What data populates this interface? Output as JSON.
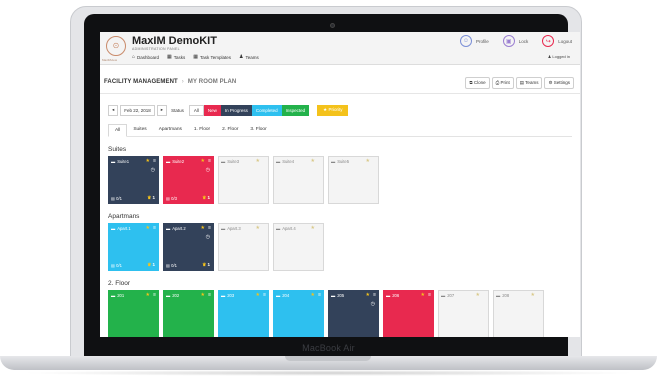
{
  "device_label": "MacBook Air",
  "app": {
    "logo_text": "⊙",
    "logo_sub": "MaxIMview",
    "title": "MaxIM DemoKIT",
    "subtitle": "ADMINISTRATION PANEL",
    "nav": [
      {
        "icon": "⌂",
        "label": "Dashboard"
      },
      {
        "icon": "▦",
        "label": "Tasks"
      },
      {
        "icon": "▦",
        "label": "Task Templates"
      },
      {
        "icon": "♟",
        "label": "Teams"
      }
    ],
    "actions": [
      {
        "icon": "☺",
        "label": "Profile",
        "color": "#7b8fd6"
      },
      {
        "icon": "▣",
        "label": "Lock",
        "color": "#9b7fd1"
      },
      {
        "icon": "↪",
        "label": "Logout",
        "color": "#e8294f"
      }
    ],
    "logged_in": "Logged in"
  },
  "page": {
    "breadcrumb_main": "FACILITY MANAGEMENT",
    "breadcrumb_sep": "›",
    "breadcrumb_sub": "MY ROOM PLAN",
    "buttons": [
      "⧉ Clone",
      "⎙ Print",
      "▤ Teams",
      "⚙ Settings"
    ]
  },
  "filters": {
    "prev": "◂",
    "date": "Feb 22, 2018",
    "next": "▸",
    "status_label": "Status",
    "statuses": [
      {
        "key": "all",
        "label": "All"
      },
      {
        "key": "new",
        "label": "New"
      },
      {
        "key": "prog",
        "label": "In Progress"
      },
      {
        "key": "comp",
        "label": "Completed"
      },
      {
        "key": "insp",
        "label": "Inspected"
      }
    ],
    "priority": "★ Priority"
  },
  "tabs": [
    "All",
    "Suites",
    "Apartmans",
    "1. Floor",
    "2. Floor",
    "3. Floor"
  ],
  "sections": [
    {
      "title": "Suites",
      "rooms": [
        {
          "name": "Suite1",
          "style": "navy",
          "menu": true,
          "clock": true,
          "foot": "0/1",
          "badge": "1"
        },
        {
          "name": "Suite2",
          "style": "red",
          "menu": true,
          "clock": true,
          "foot": "0/3",
          "badge": "1"
        },
        {
          "name": "Suite3",
          "style": "empty"
        },
        {
          "name": "Suite4",
          "style": "empty"
        },
        {
          "name": "Suite5",
          "style": "empty"
        }
      ]
    },
    {
      "title": "Apartmans",
      "rooms": [
        {
          "name": "Apart.1",
          "style": "blue",
          "menu": true,
          "clock": false,
          "foot": "0/1",
          "badge": "1"
        },
        {
          "name": "Apart.2",
          "style": "navy",
          "menu": true,
          "clock": true,
          "foot": "0/1",
          "badge": "1"
        },
        {
          "name": "Apart.3",
          "style": "empty"
        },
        {
          "name": "Apart.4",
          "style": "empty"
        }
      ]
    },
    {
      "title": "2. Floor",
      "rooms": [
        {
          "name": "201",
          "style": "green",
          "menu": true
        },
        {
          "name": "202",
          "style": "green",
          "menu": true
        },
        {
          "name": "203",
          "style": "blue",
          "menu": true
        },
        {
          "name": "204",
          "style": "blue",
          "menu": true
        },
        {
          "name": "205",
          "style": "navy",
          "menu": true,
          "clock": true
        },
        {
          "name": "206",
          "style": "red",
          "menu": true
        },
        {
          "name": "207",
          "style": "empty"
        },
        {
          "name": "208",
          "style": "empty"
        }
      ]
    }
  ]
}
